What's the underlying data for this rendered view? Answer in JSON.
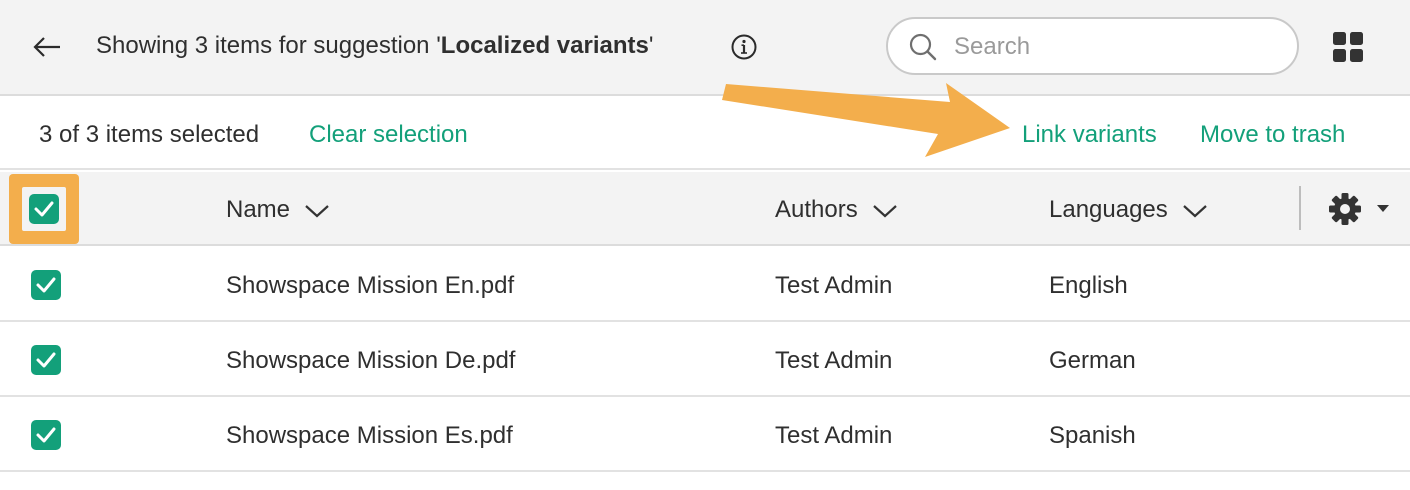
{
  "header": {
    "prefix": "Showing 3 items for suggestion ",
    "quote_open": "'",
    "suggestion": "Localized variants",
    "quote_close": "'"
  },
  "search": {
    "placeholder": "Search",
    "value": ""
  },
  "selection": {
    "count_text": "3 of 3 items selected",
    "clear_label": "Clear selection",
    "link_label": "Link variants",
    "trash_label": "Move to trash"
  },
  "table": {
    "columns": [
      "Name",
      "Authors",
      "Languages"
    ],
    "rows": [
      {
        "name": "Showspace Mission En.pdf",
        "author": "Test Admin",
        "language": "English",
        "checked": true
      },
      {
        "name": "Showspace Mission De.pdf",
        "author": "Test Admin",
        "language": "German",
        "checked": true
      },
      {
        "name": "Showspace Mission Es.pdf",
        "author": "Test Admin",
        "language": "Spanish",
        "checked": true
      }
    ]
  },
  "colors": {
    "accent": "#13a07a",
    "highlight": "#f3ae4c",
    "header_bg": "#f3f3f3"
  },
  "icons": [
    "back-arrow-icon",
    "info-icon",
    "search-icon",
    "grid-view-icon",
    "chevron-down-icon",
    "gear-icon",
    "checkmark-icon"
  ]
}
